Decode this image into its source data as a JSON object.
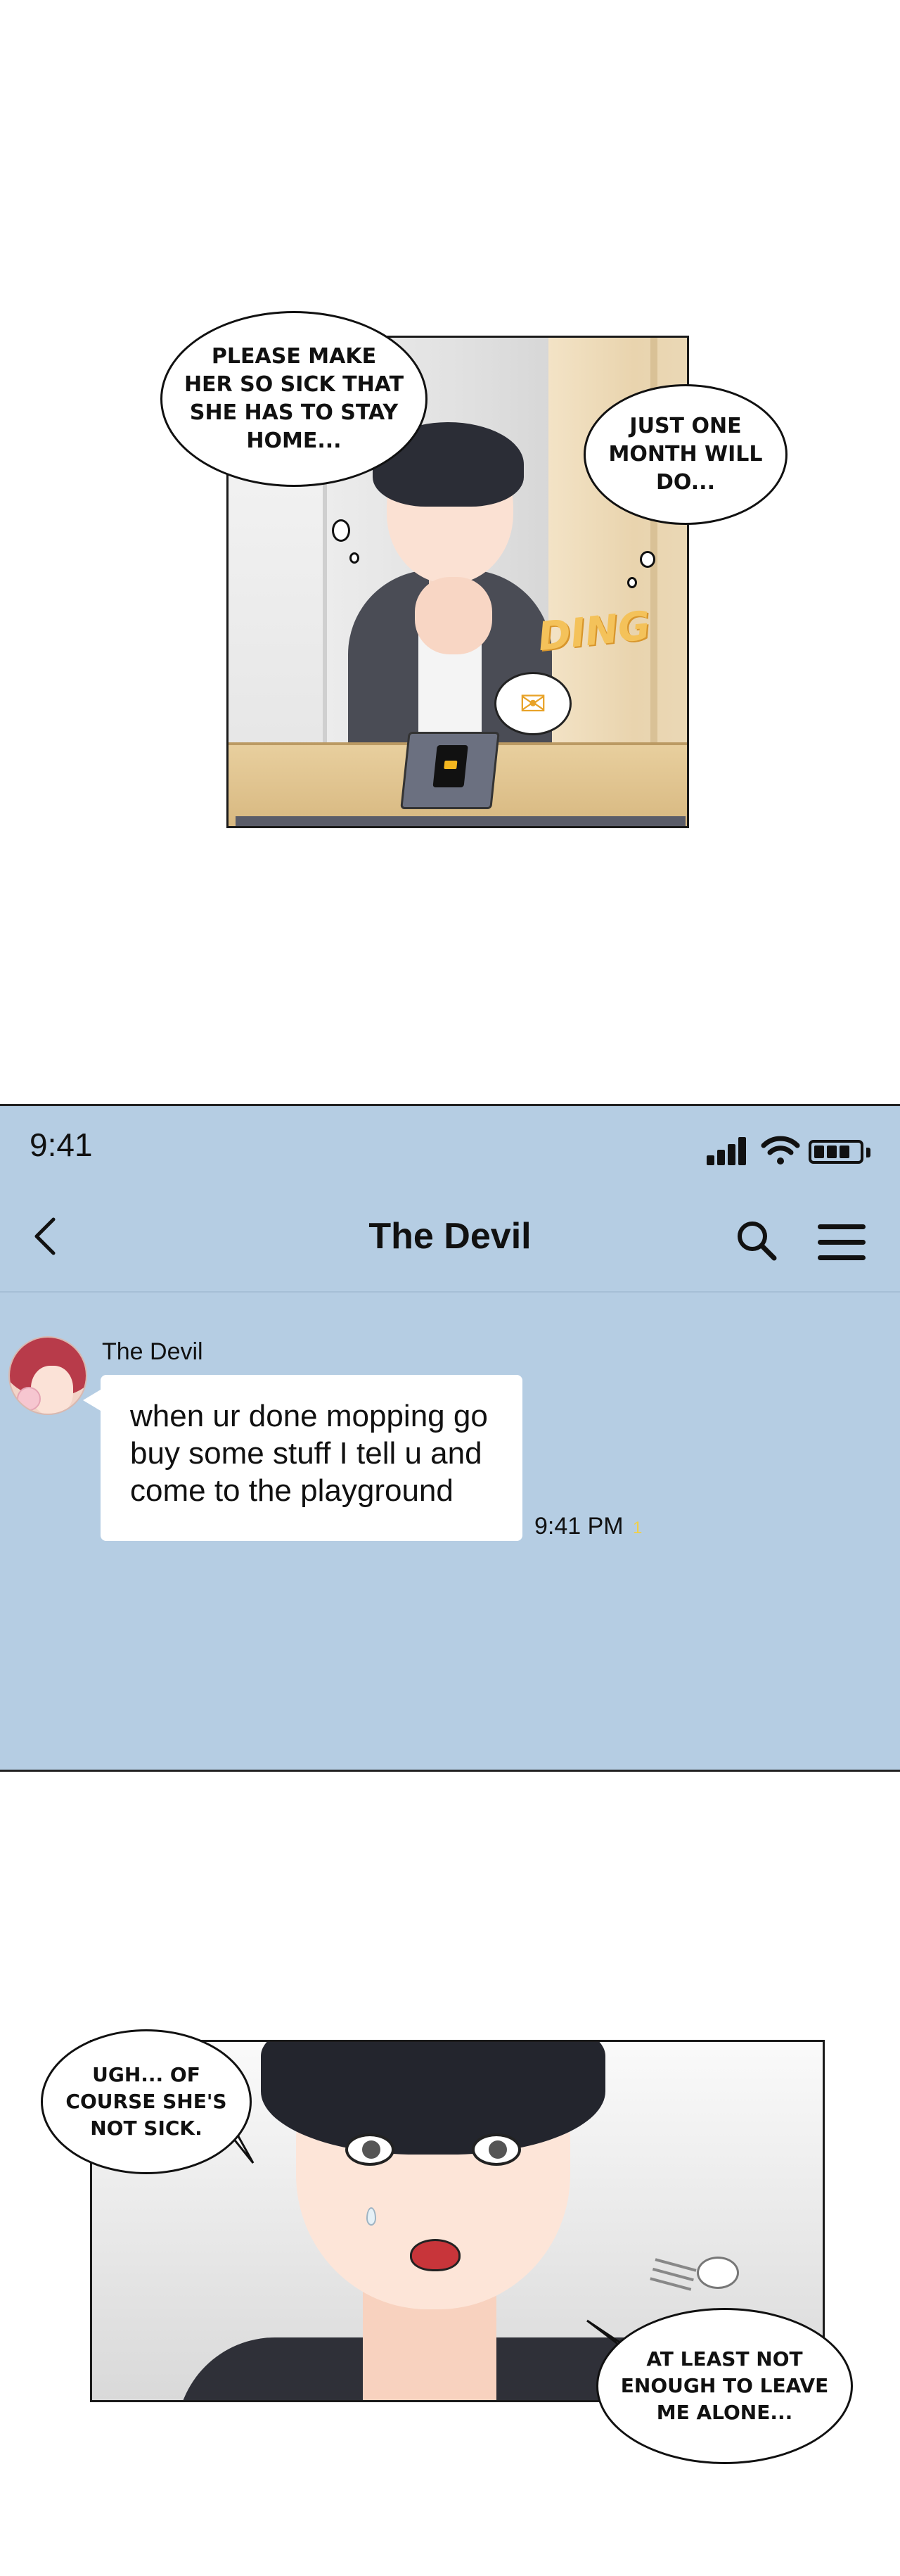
{
  "panel1": {
    "bubble_left": "PLEASE MAKE\nHER SO SICK THAT\nSHE HAS TO STAY\nHOME...",
    "bubble_right": "JUST ONE\nMONTH WILL\nDO...",
    "sfx": "DING",
    "mail_icon": "envelope-icon"
  },
  "chat": {
    "status_bar": {
      "time": "9:41"
    },
    "header": {
      "title": "The Devil"
    },
    "message": {
      "sender": "The Devil",
      "text": "when ur done mopping go buy some stuff I tell u and come to the playground",
      "time": "9:41 PM",
      "read_mark": "1"
    },
    "icons": [
      "back-chevron-icon",
      "search-icon",
      "menu-icon",
      "signal-icon",
      "wifi-icon",
      "battery-icon"
    ],
    "colors": {
      "background": "#b5cde3",
      "bubble": "#ffffff",
      "read_mark": "#f0d048"
    }
  },
  "panel3": {
    "bubble_left": "UGH... OF\nCOURSE SHE'S\nNOT SICK.",
    "bubble_right": "AT LEAST NOT\nENOUGH TO LEAVE\nME ALONE..."
  }
}
